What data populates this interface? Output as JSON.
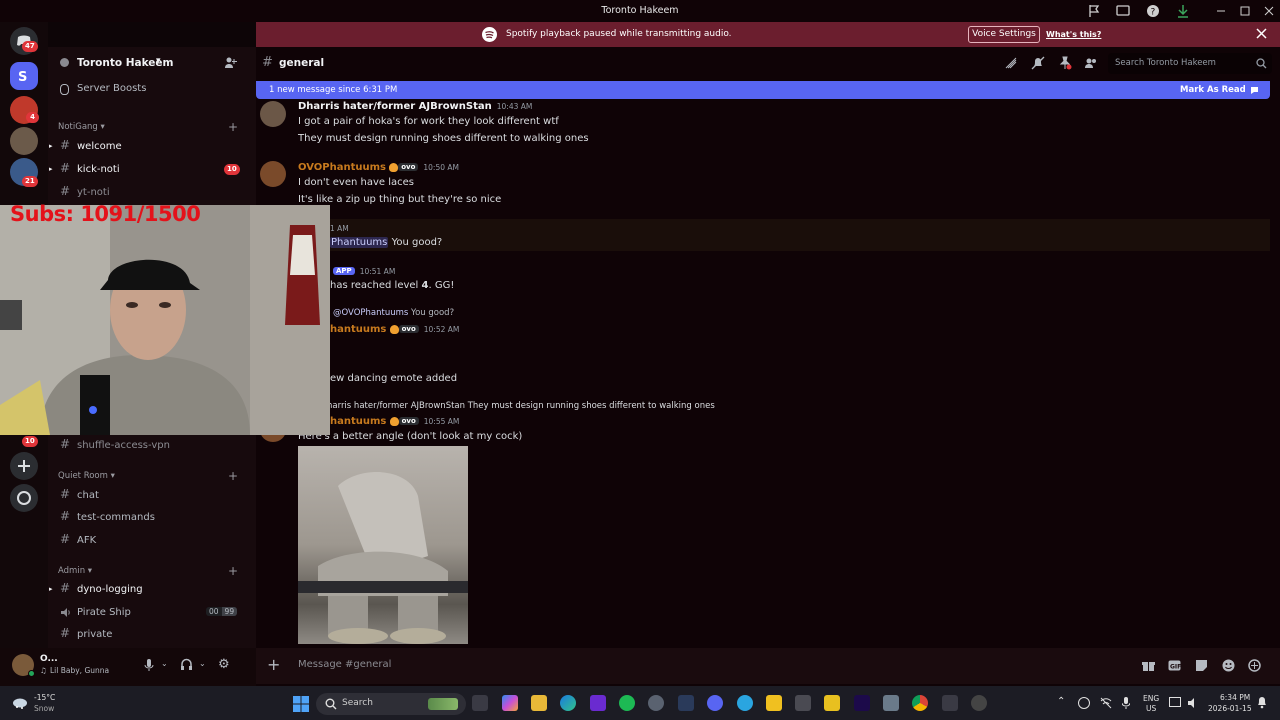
{
  "titlebar": {
    "title": "Toronto Hakeem"
  },
  "notice": {
    "text": "Spotify playback paused while transmitting audio.",
    "button": "Voice Settings",
    "link": "What's this?"
  },
  "rail": {
    "dm_badge": "47",
    "server_badges": [
      "4",
      "21"
    ],
    "bottom_badge": "10"
  },
  "server": {
    "name": "Toronto Hakeem",
    "boosts": "Server Boosts"
  },
  "categories": [
    {
      "name": "NotiGang",
      "channels": [
        {
          "name": "welcome",
          "unread": true,
          "badge": ""
        },
        {
          "name": "kick-noti",
          "unread": true,
          "badge": "10"
        },
        {
          "name": "yt-noti",
          "unread": false,
          "badge": ""
        }
      ]
    },
    {
      "name": "Quiet Room",
      "channels": [
        {
          "name": "chat"
        },
        {
          "name": "test-commands"
        },
        {
          "name": "AFK"
        }
      ]
    },
    {
      "name": "Admin",
      "channels": [
        {
          "name": "dyno-logging"
        },
        {
          "name": "Pirate Ship",
          "c1": "00",
          "c2": "99"
        },
        {
          "name": "private"
        }
      ]
    }
  ],
  "partial_channel": "shuffle-access-vpn",
  "user": {
    "name": "O...",
    "status": "Lil Baby, Gunna"
  },
  "channel": {
    "name": "general",
    "search_placeholder": "Search Toronto Hakeem"
  },
  "newbar": {
    "text": "1 new message since 6:31 PM",
    "action": "Mark As Read"
  },
  "messages": {
    "m1": {
      "author": "Dharris hater/former AJBrownStan",
      "time": "10:43 AM",
      "lines": [
        "I got a pair of hoka's for work they look different wtf",
        "They must design running shoes different to walking ones"
      ]
    },
    "m2": {
      "author": "OVOPhantuums",
      "tag": "ovo",
      "time": "10:50 AM",
      "lines": [
        "I don't even have laces",
        "It's like a zip up thing but they're so nice"
      ]
    },
    "m3": {
      "time": "1 AM",
      "author": "Phantuums",
      "text": "You good?"
    },
    "m4": {
      "tag": "APP",
      "time": "10:51 AM",
      "text_pre": "has reached level ",
      "level": "4",
      "text_post": ". GG!"
    },
    "m5": {
      "mention": "@OVOPhantuums",
      "reply": "You good?",
      "author": "hantuums",
      "tag": "ovo",
      "time": "10:52 AM"
    },
    "m6": {
      "text": "ew dancing emote added"
    },
    "m7": {
      "reply_author": "harris hater/former AJBrownStan",
      "reply_text": "They must design running shoes different to walking ones",
      "author": "hantuums",
      "tag": "ovo",
      "time": "10:55 AM",
      "text": "Here's a better angle (don't look at my cock)"
    }
  },
  "overlay": {
    "subs": "Subs: 1091/1500"
  },
  "compose": {
    "placeholder": "Message #general"
  },
  "taskbar": {
    "weather_temp": "-15°C",
    "weather_text": "Snow",
    "search": "Search",
    "lang": "ENG",
    "region": "US",
    "time": "6:34 PM",
    "date": "2026-01-15"
  },
  "colors": {
    "accent": "#5865f2",
    "ovo_author": "#c77a1e",
    "mention": "#c9cdfb"
  }
}
